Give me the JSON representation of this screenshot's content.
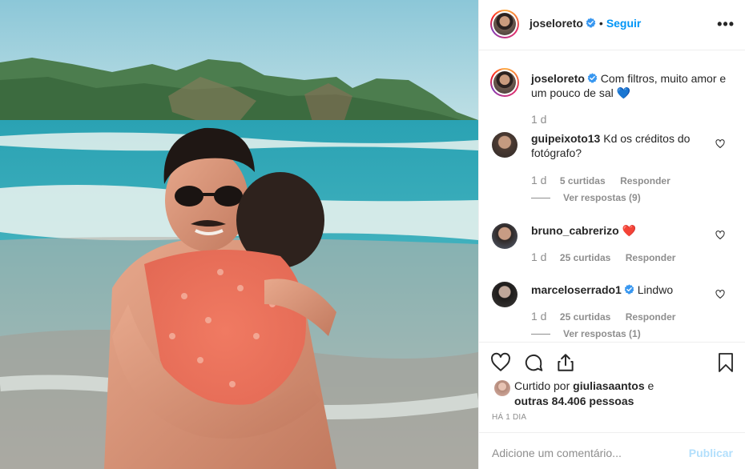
{
  "post": {
    "author": "joseloreto",
    "follow_label": "Seguir",
    "separator": "•",
    "more_label": "•••"
  },
  "caption": {
    "username": "joseloreto",
    "text": "Com filtros, muito amor e um pouco de sal",
    "emoji": "💙",
    "time": "1 d"
  },
  "comments": [
    {
      "username": "guipeixoto13",
      "text": "Kd os créditos do fotógrafo?",
      "time": "1 d",
      "likes": "5 curtidas",
      "reply_label": "Responder",
      "view_replies": "Ver respostas (9)"
    },
    {
      "username": "bruno_cabrerizo",
      "text": "❤️",
      "time": "1 d",
      "likes": "25 curtidas",
      "reply_label": "Responder"
    },
    {
      "username": "marceloserrado1",
      "text": "Lindwo",
      "time": "1 d",
      "likes": "25 curtidas",
      "reply_label": "Responder",
      "view_replies": "Ver respostas (1)"
    }
  ],
  "likes": {
    "prefix": "Curtido por",
    "user": "giuliasaantos",
    "middle": "e",
    "others": "outras 84.406 pessoas"
  },
  "timestamp": "HÁ 1 DIA",
  "add_comment": {
    "placeholder": "Adicione um comentário...",
    "publish_label": "Publicar"
  },
  "icons": {
    "verified": "verified-badge-icon",
    "like": "heart-icon",
    "comment": "comment-bubble-icon",
    "share": "share-icon",
    "save": "bookmark-icon",
    "more": "more-options-icon"
  },
  "colors": {
    "link_blue": "#0095f6",
    "publish_disabled": "#b2dffc",
    "muted": "#8e8e8e",
    "text": "#262626"
  }
}
